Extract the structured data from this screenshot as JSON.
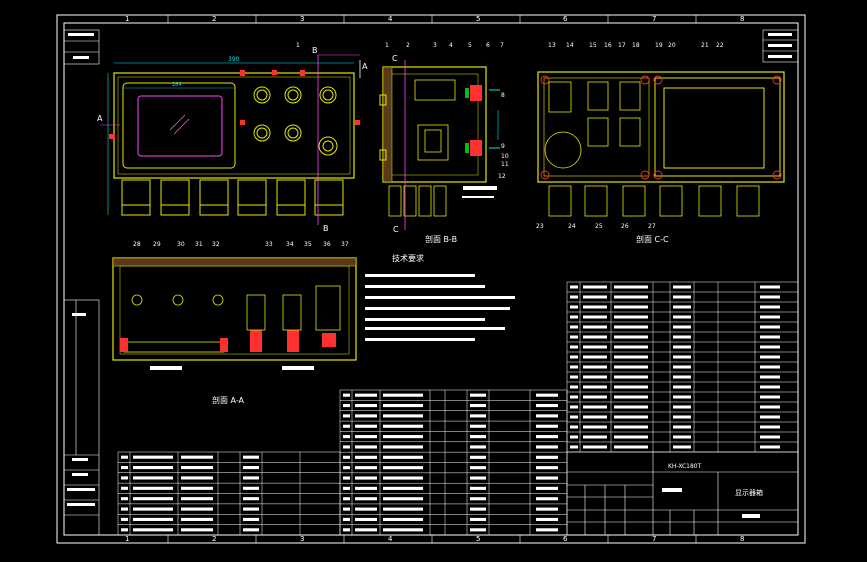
{
  "colors": {
    "background": "#000000",
    "frame": "#ffffff",
    "outline": "#e6e600",
    "cyan": "#00e5e5",
    "red": "#ff3030",
    "magenta": "#ff44ff",
    "green": "#00c000"
  },
  "border": {
    "top_numbers": [
      "1",
      "2",
      "3",
      "4",
      "5",
      "6",
      "7",
      "8"
    ],
    "bottom_numbers": [
      "1",
      "2",
      "3",
      "4",
      "5",
      "6",
      "7",
      "8"
    ]
  },
  "views": {
    "front": {
      "width_dim": "390",
      "screen_dim": "284",
      "marker_left": "A",
      "marker_right": "A",
      "marker_top": "B",
      "marker_bottom": "B"
    },
    "section_bb": {
      "title": "剖面 B-B",
      "callouts": [
        "1",
        "2",
        "3",
        "4",
        "5",
        "6",
        "7",
        "8",
        "9",
        "10",
        "11",
        "12"
      ],
      "marker": "C"
    },
    "section_cc": {
      "title": "剖面 C-C",
      "callouts_top": [
        "13",
        "14",
        "15",
        "16",
        "17",
        "18",
        "19",
        "20",
        "21",
        "22"
      ],
      "callouts_bottom": [
        "23",
        "24",
        "25",
        "26",
        "27"
      ]
    },
    "section_aa": {
      "title": "剖面 A-A",
      "callouts": [
        "28",
        "29",
        "30",
        "31",
        "32",
        "33",
        "34",
        "35",
        "36",
        "37"
      ]
    }
  },
  "tech_requirements": {
    "title": "技术要求"
  },
  "title_block": {
    "drawing_no": "KH-XC180T",
    "name": "显示器箱"
  }
}
